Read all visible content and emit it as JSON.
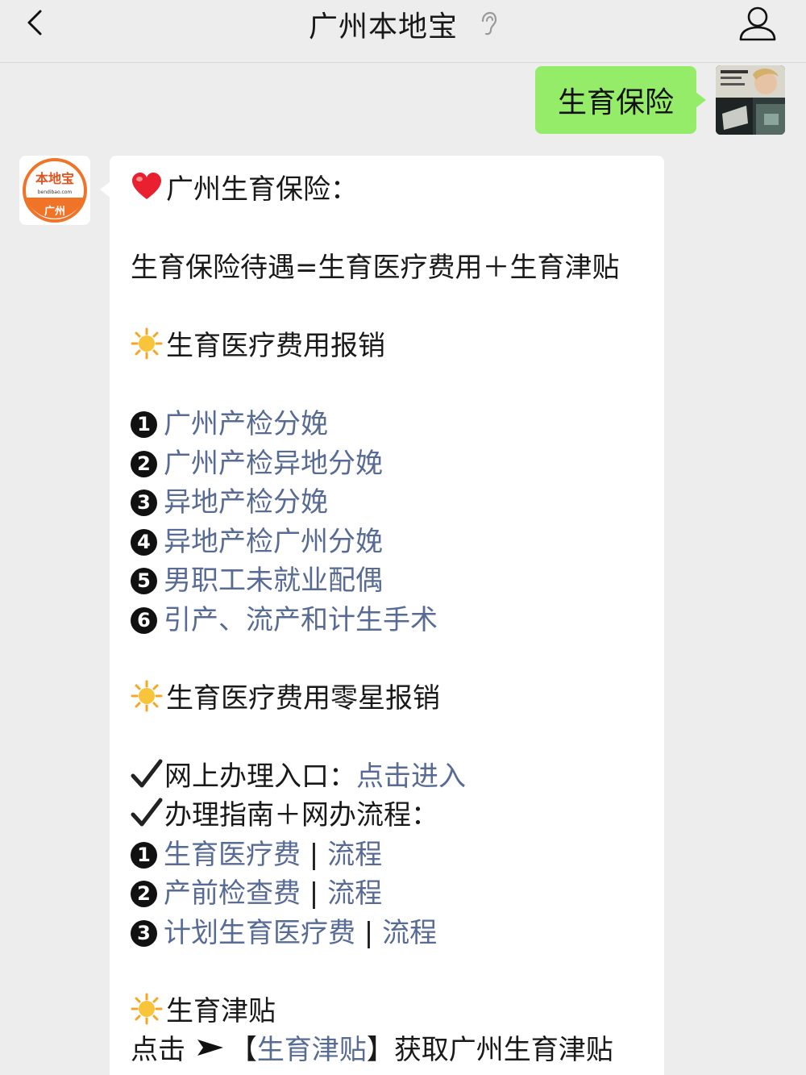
{
  "nav": {
    "title": "广州本地宝",
    "back_icon": "chevron-left-icon",
    "ear_icon": "ear-icon",
    "profile_icon": "person-icon"
  },
  "outgoing": {
    "text": "生育保险"
  },
  "bot_avatar": {
    "brand": "本地宝",
    "domain": "bendibao.com",
    "city": "广州"
  },
  "message": {
    "title": "广州生育保险：",
    "formula": "生育保险待遇=生育医疗费用＋生育津贴",
    "section1": "生育医疗费用报销",
    "items1": [
      {
        "num": "1",
        "text": "广州产检分娩"
      },
      {
        "num": "2",
        "text": "广州产检异地分娩"
      },
      {
        "num": "3",
        "text": "异地产检分娩"
      },
      {
        "num": "4",
        "text": "异地产检广州分娩"
      },
      {
        "num": "5",
        "text": "男职工未就业配偶"
      },
      {
        "num": "6",
        "text": "引产、流产和计生手术"
      }
    ],
    "section2": "生育医疗费用零星报销",
    "online_label": "网上办理入口：",
    "online_link": "点击进入",
    "guide_label": "办理指南＋网办流程：",
    "items2": [
      {
        "num": "1",
        "text": "生育医疗费",
        "sep": " | ",
        "link2": "流程"
      },
      {
        "num": "2",
        "text": "产前检查费",
        "sep": " | ",
        "link2": "流程"
      },
      {
        "num": "3",
        "text": "计划生育医疗费",
        "sep": " | ",
        "link2": "流程"
      }
    ],
    "section3": "生育津贴",
    "final_prefix": "点击",
    "final_bracket_open": "【",
    "final_link": "生育津贴",
    "final_bracket_close": "】",
    "final_suffix": "获取广州生育津贴"
  },
  "colors": {
    "bg": "#ededed",
    "green_bubble": "#95ec69",
    "link": "#576b95",
    "heart": "#e8202f",
    "sun": "#f6a623"
  }
}
